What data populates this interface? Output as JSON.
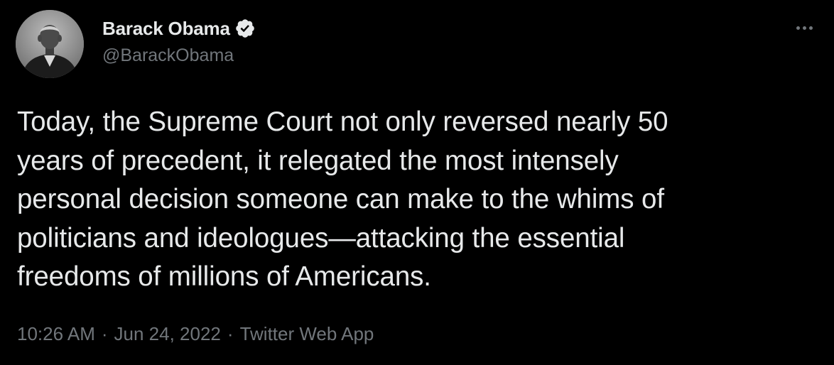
{
  "author": {
    "display_name": "Barack Obama",
    "handle": "@BarackObama",
    "verified": true,
    "avatar": "profile-photo-grayscale"
  },
  "menu": {
    "icon": "more-horizontal-icon"
  },
  "tweet": {
    "text": "Today, the Supreme Court not only reversed nearly 50\nyears of precedent, it relegated the most intensely\npersonal decision someone can make to the whims of\npoliticians and ideologues—attacking the essential\nfreedoms of millions of Americans."
  },
  "meta": {
    "time": "10:26 AM",
    "date": "Jun 24, 2022",
    "source": "Twitter Web App",
    "separator": "·"
  },
  "colors": {
    "background": "#000000",
    "text": "#e7e9ea",
    "muted": "#71767b"
  }
}
